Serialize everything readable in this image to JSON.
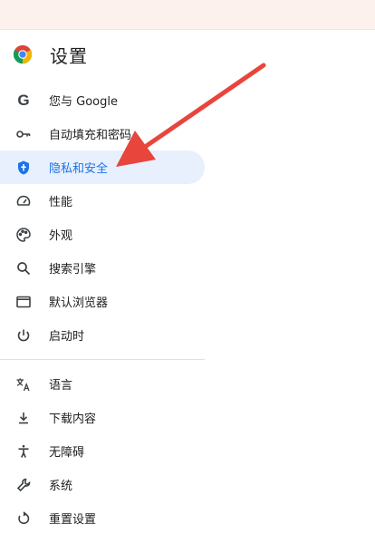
{
  "app": {
    "title": "设置",
    "logo_icon": "chrome-logo-icon"
  },
  "accent_color": "#1a73e8",
  "annotation_color": "#e8453c",
  "sidebar": {
    "active_index": 2,
    "items": [
      {
        "label": "您与 Google",
        "icon": "google-g-icon"
      },
      {
        "label": "自动填充和密码",
        "icon": "key-icon"
      },
      {
        "label": "隐私和安全",
        "icon": "shield-icon"
      },
      {
        "label": "性能",
        "icon": "speedometer-icon"
      },
      {
        "label": "外观",
        "icon": "palette-icon"
      },
      {
        "label": "搜索引擎",
        "icon": "search-icon"
      },
      {
        "label": "默认浏览器",
        "icon": "browser-window-icon"
      },
      {
        "label": "启动时",
        "icon": "power-icon"
      }
    ],
    "advanced_items": [
      {
        "label": "语言",
        "icon": "translate-icon"
      },
      {
        "label": "下载内容",
        "icon": "download-icon"
      },
      {
        "label": "无障碍",
        "icon": "accessibility-icon"
      },
      {
        "label": "系统",
        "icon": "wrench-icon"
      },
      {
        "label": "重置设置",
        "icon": "reset-icon"
      }
    ]
  }
}
